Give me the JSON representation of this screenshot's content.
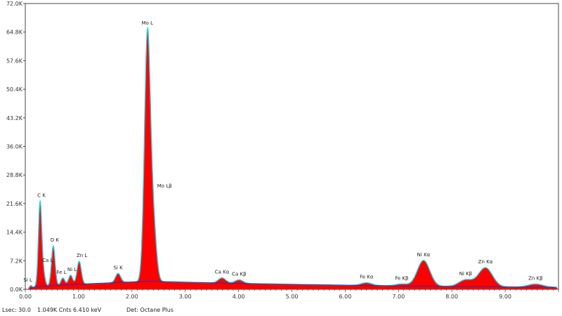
{
  "status_bar": {
    "lsec": "Lsec: 30.0",
    "counts": "1.049K Cnts",
    "energy": "6.410 keV",
    "detector": "Det: Octane Plus"
  },
  "colors": {
    "fill": "#ff0000",
    "outline": "#33ccdd",
    "background_line": "#2233aa",
    "axis": "#444444"
  },
  "chart_data": {
    "type": "area",
    "title": "",
    "xlabel": "",
    "ylabel": "",
    "xlim": [
      0,
      10.0
    ],
    "ylim": [
      0,
      72000
    ],
    "x_ticks": [
      0,
      1,
      2,
      3,
      4,
      5,
      6,
      7,
      8,
      9
    ],
    "x_tick_labels": [
      "0.00",
      "1.00",
      "2.00",
      "3.00",
      "4.00",
      "5.00",
      "6.00",
      "7.00",
      "8.00",
      "9.00"
    ],
    "y_ticks": [
      0,
      7200,
      14400,
      21600,
      28800,
      36000,
      43200,
      50400,
      57600,
      64800,
      72000
    ],
    "y_tick_labels": [
      "0.0K",
      "7.2K",
      "14.4K",
      "21.6K",
      "28.8K",
      "36.0K",
      "43.2K",
      "50.4K",
      "57.6K",
      "64.8K",
      "72.0K"
    ],
    "grid": false,
    "background_level": 1400,
    "peaks": [
      {
        "label": "Si L",
        "energy": 0.1,
        "height": 800
      },
      {
        "label": "C  K",
        "energy": 0.277,
        "height": 21000
      },
      {
        "label": "O  K",
        "energy": 0.525,
        "height": 10000
      },
      {
        "label": "Ca L",
        "energy": 0.34,
        "height": 3000
      },
      {
        "label": "Fe L",
        "energy": 0.705,
        "height": 1800
      },
      {
        "label": "Ni L",
        "energy": 0.85,
        "height": 2400
      },
      {
        "label": "Zn L",
        "energy": 1.01,
        "height": 5800
      },
      {
        "label": "Si K",
        "energy": 1.74,
        "height": 2300
      },
      {
        "label": "Mo L",
        "energy": 2.29,
        "height": 61500
      },
      {
        "label": "Mo Lβ",
        "energy": 2.4,
        "height": 14000
      },
      {
        "label": "Ca Kα",
        "energy": 3.69,
        "height": 1300
      },
      {
        "label": "Ca Kβ",
        "energy": 4.01,
        "height": 900
      },
      {
        "label": "Fe Kα",
        "energy": 6.4,
        "height": 700
      },
      {
        "label": "Fe Kβ",
        "energy": 7.06,
        "height": 500
      },
      {
        "label": "Ni Kα",
        "energy": 7.47,
        "height": 6500
      },
      {
        "label": "Ni Kβ",
        "energy": 8.26,
        "height": 1700
      },
      {
        "label": "Zn Kα",
        "energy": 8.63,
        "height": 4800
      },
      {
        "label": "Zn Kβ",
        "energy": 9.57,
        "height": 800
      }
    ]
  }
}
